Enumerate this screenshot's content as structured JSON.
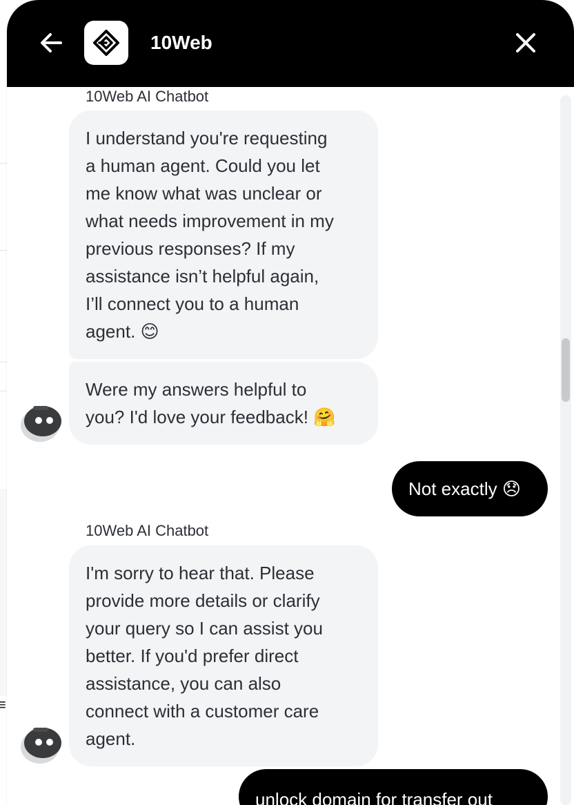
{
  "header": {
    "title": "10Web",
    "back_icon": "arrow-left-icon",
    "logo_icon": "10web-logo-icon",
    "close_icon": "close-icon"
  },
  "messages": [
    {
      "role": "bot",
      "sender": "10Web AI Chatbot",
      "lines": [
        "I understand you're requesting",
        "a human agent. Could you let",
        "me know what was unclear or",
        "what needs improvement in my",
        "previous responses? If my",
        "assistance isn’t helpful again,",
        "I’ll connect you to a human",
        "agent. 😊"
      ]
    },
    {
      "role": "bot",
      "lines": [
        "Were my answers helpful to",
        "you? I'd love your feedback! 🤗"
      ]
    },
    {
      "role": "user",
      "text": "Not exactly 😞"
    },
    {
      "role": "bot",
      "sender": "10Web AI Chatbot",
      "lines": [
        "I'm sorry to hear that. Please",
        "provide more details or clarify",
        "your query so I can assist you",
        "better. If you'd prefer direct",
        "assistance, you can also",
        "connect with a customer care",
        "agent."
      ]
    },
    {
      "role": "user",
      "text": "unlock domain for transfer out"
    }
  ],
  "colors": {
    "header_bg": "#000000",
    "bot_bubble": "#f3f4f6",
    "user_bubble": "#000000",
    "text": "#2b2f36"
  }
}
